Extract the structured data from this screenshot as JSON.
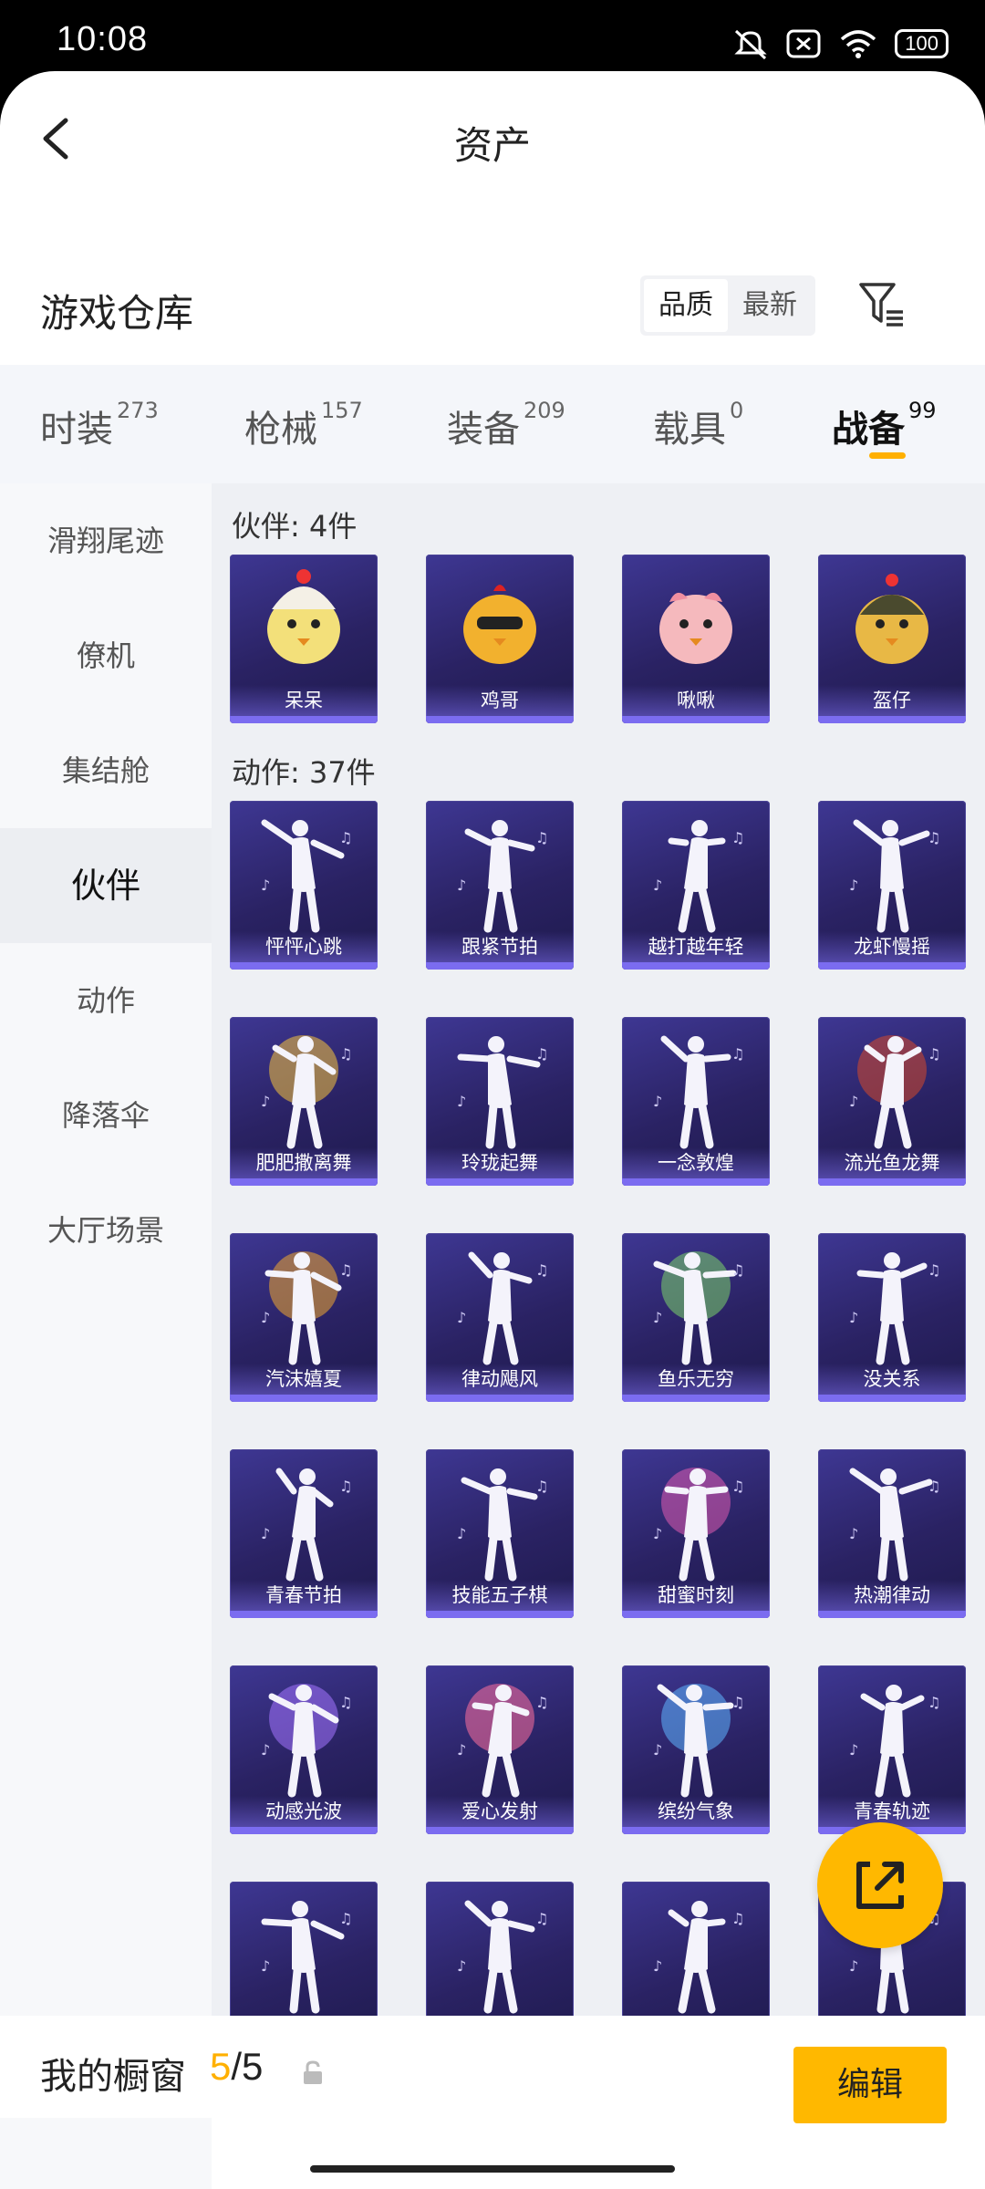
{
  "status": {
    "time": "10:08",
    "battery": "100"
  },
  "header": {
    "title": "资产"
  },
  "section": {
    "title": "游戏仓库",
    "sort_options": [
      "品质",
      "最新"
    ],
    "active_sort": "品质"
  },
  "tabs": [
    {
      "label": "时装",
      "count": "273"
    },
    {
      "label": "枪械",
      "count": "157"
    },
    {
      "label": "装备",
      "count": "209"
    },
    {
      "label": "载具",
      "count": "0"
    },
    {
      "label": "战备",
      "count": "99"
    }
  ],
  "sidebar": [
    {
      "label": "滑翔尾迹"
    },
    {
      "label": "僚机"
    },
    {
      "label": "集结舱"
    },
    {
      "label": "伙伴"
    },
    {
      "label": "动作"
    },
    {
      "label": "降落伞"
    },
    {
      "label": "大厅场景"
    }
  ],
  "groups": [
    {
      "title": "伙伴: 4件",
      "items": [
        "呆呆",
        "鸡哥",
        "啾啾",
        "盔仔"
      ]
    },
    {
      "title": "动作: 37件",
      "items": [
        "怦怦心跳",
        "跟紧节拍",
        "越打越年轻",
        "龙虾慢摇",
        "肥肥撒离舞",
        "玲珑起舞",
        "一念敦煌",
        "流光鱼龙舞",
        "汽沫嬉夏",
        "律动飓风",
        "鱼乐无穷",
        "没关系",
        "青春节拍",
        "技能五子棋",
        "甜蜜时刻",
        "热潮律动",
        "动感光波",
        "爱心发射",
        "缤纷气象",
        "青春轨迹",
        "",
        "",
        "",
        ""
      ]
    }
  ],
  "bottom": {
    "label": "我的橱窗",
    "count_current": "5",
    "count_sep": "/5",
    "edit_label": "编辑"
  }
}
